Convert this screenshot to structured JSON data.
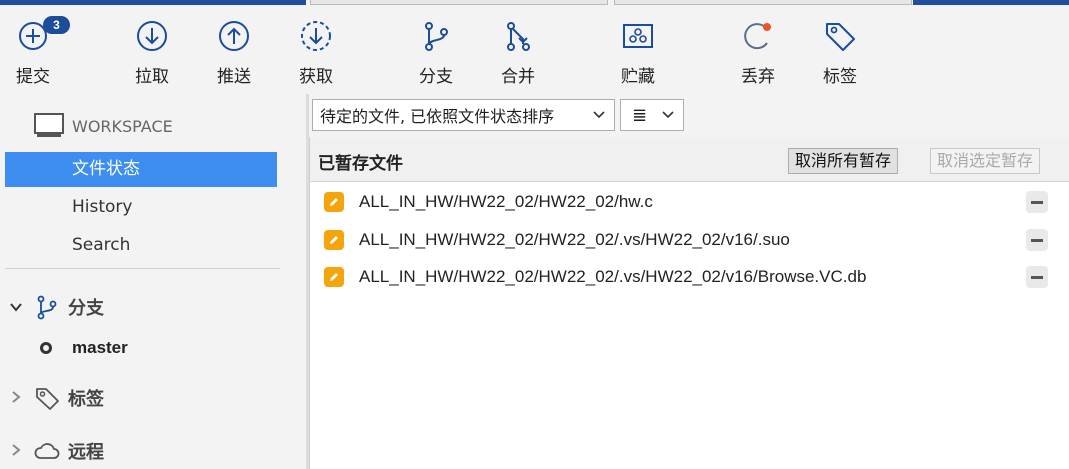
{
  "toolbar": {
    "commit_label": "提交",
    "commit_badge": "3",
    "pull_label": "拉取",
    "push_label": "推送",
    "fetch_label": "获取",
    "branch_label": "分支",
    "merge_label": "合并",
    "stash_label": "贮藏",
    "discard_label": "丢弃",
    "tag_label": "标签"
  },
  "sidebar": {
    "workspace_label": "WORKSPACE",
    "workspace_items": [
      {
        "label": "文件状态"
      },
      {
        "label": "History"
      },
      {
        "label": "Search"
      }
    ],
    "branches_label": "分支",
    "current_branch": "master",
    "tags_label": "标签",
    "remotes_label": "远程"
  },
  "main": {
    "sort_dropdown_value": "待定的文件, 已依照文件状态排序",
    "view_mode_icon": "≣",
    "staged_title": "已暂存文件",
    "unstage_all_label": "取消所有暂存",
    "unstage_selected_label": "取消选定暂存",
    "staged_files": [
      {
        "path": "ALL_IN_HW/HW22_02/HW22_02/hw.c"
      },
      {
        "path": "ALL_IN_HW/HW22_02/HW22_02/.vs/HW22_02/v16/.suo"
      },
      {
        "path": "ALL_IN_HW/HW22_02/HW22_02/.vs/HW22_02/v16/Browse.VC.db"
      }
    ]
  },
  "colors": {
    "accent_blue": "#1f4e9c",
    "selection_blue": "#3d8ef0",
    "modified_orange": "#f5a40a",
    "discard_dot": "#f0522e"
  }
}
